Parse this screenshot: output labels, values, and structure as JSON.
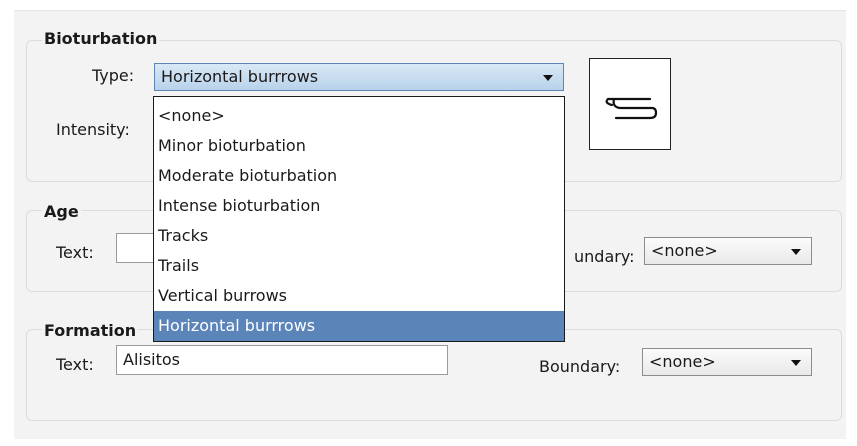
{
  "bioturbation": {
    "title": "Bioturbation",
    "type_label": "Type:",
    "type_value": "Horizontal burrrows",
    "intensity_label": "Intensity:",
    "preview_icon": "horizontal-burrow-symbol",
    "dropdown_options": [
      "<none>",
      "Minor bioturbation",
      "Moderate bioturbation",
      "Intense bioturbation",
      "Tracks",
      "Trails",
      "Vertical burrows",
      "Horizontal burrrows"
    ],
    "selected_option": "Horizontal burrrows"
  },
  "age": {
    "title": "Age",
    "text_label": "Text:",
    "text_value": "",
    "boundary_label": "Boundary:",
    "boundary_label_visible": "undary:",
    "boundary_value": "<none>"
  },
  "formation": {
    "title": "Formation",
    "text_label": "Text:",
    "text_value": "Alisitos",
    "boundary_label": "Boundary:",
    "boundary_value": "<none>"
  },
  "colors": {
    "selection": "#5b84b8",
    "panel": "#f3f3f3"
  }
}
